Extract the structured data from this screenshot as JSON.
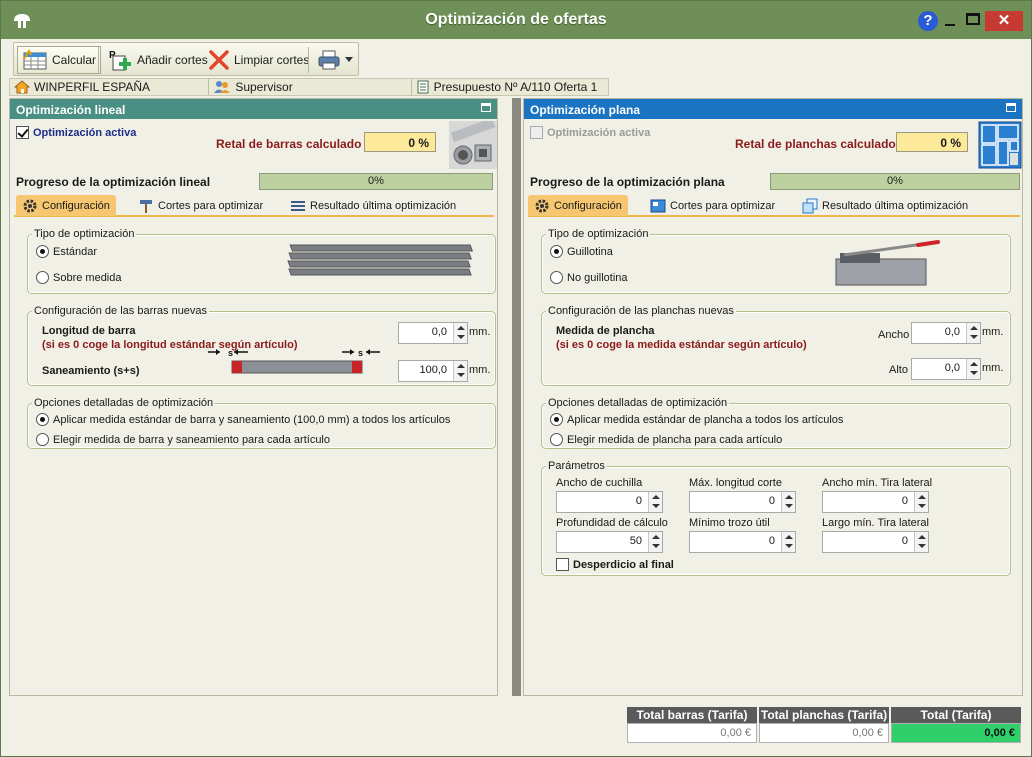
{
  "window": {
    "title": "Optimización de ofertas",
    "help_label": "?",
    "close_label": "✕"
  },
  "toolbar": {
    "calcular": "Calcular",
    "anadir": "Añadir cortes",
    "limpiar": "Limpiar cortes"
  },
  "info": {
    "company": "WINPERFIL ESPAÑA",
    "user": "Supervisor",
    "presupuesto": "Presupuesto Nº A/110 Oferta 1"
  },
  "lineal": {
    "header": "Optimización lineal",
    "activa_label": "Optimización activa",
    "retal_label": "Retal de barras calculado",
    "retal_value": "0 %",
    "progress_label": "Progreso de la optimización lineal",
    "progress_text": "0%",
    "progress_value": 0,
    "tabs": [
      "Configuración",
      "Cortes para optimizar",
      "Resultado última optimización"
    ],
    "tipo_title": "Tipo de optimización",
    "tipo_opts": [
      "Estándar",
      "Sobre medida"
    ],
    "nuevas_title": "Configuración de las barras nuevas",
    "longitud_label": "Longitud de barra",
    "longitud_note": "(si es 0 coge la longitud estándar según artículo)",
    "longitud_value": "0,0",
    "saneamiento_label": "Saneamiento (s+s)",
    "saneamiento_value": "100,0",
    "unit": "mm.",
    "detalladas_title": "Opciones detalladas de optimización",
    "detalladas_opts": [
      "Aplicar medida estándar de barra y saneamiento (100,0 mm) a todos los artículos",
      "Elegir medida de barra y saneamiento para cada artículo"
    ],
    "s_label": "s"
  },
  "plana": {
    "header": "Optimización plana",
    "activa_label": "Optimización activa",
    "retal_label": "Retal de planchas calculado",
    "retal_value": "0 %",
    "progress_label": "Progreso de la optimización plana",
    "progress_text": "0%",
    "progress_value": 0,
    "tabs": [
      "Configuración",
      "Cortes para optimizar",
      "Resultado última optimización"
    ],
    "tipo_title": "Tipo de optimización",
    "tipo_opts": [
      "Guillotina",
      "No guillotina"
    ],
    "nuevas_title": "Configuración de las planchas nuevas",
    "medida_label": "Medida de plancha",
    "medida_note": "(si es 0 coge la medida estándar según artículo)",
    "ancho_label": "Ancho",
    "ancho_value": "0,0",
    "alto_label": "Alto",
    "alto_value": "0,0",
    "unit": "mm.",
    "detalladas_title": "Opciones detalladas de optimización",
    "detalladas_opts": [
      "Aplicar medida estándar de plancha a todos los artículos",
      "Elegir medida de plancha para cada artículo"
    ],
    "parametros_title": "Parámetros",
    "params": [
      {
        "label": "Ancho de cuchilla",
        "value": "0"
      },
      {
        "label": "Máx. longitud corte",
        "value": "0"
      },
      {
        "label": "Ancho mín. Tira lateral",
        "value": "0"
      },
      {
        "label": "Profundidad de cálculo",
        "value": "50"
      },
      {
        "label": "Mínimo trozo útil",
        "value": "0"
      },
      {
        "label": "Largo mín. Tira lateral",
        "value": "0"
      }
    ],
    "desperdicio_label": "Desperdicio al final"
  },
  "totals": {
    "barras_label": "Total barras (Tarifa)",
    "barras_value": "0,00 €",
    "planchas_label": "Total planchas (Tarifa)",
    "planchas_value": "0,00 €",
    "total_label": "Total (Tarifa)",
    "total_value": "0,00 €"
  },
  "colors": {
    "title_bg": "#6e8f57",
    "lineal_header": "#4a8f84",
    "plana_header": "#1b74c2",
    "tab_active": "#f6c770",
    "retal_box": "#fde99a",
    "total_ok": "#2fcf6a"
  }
}
